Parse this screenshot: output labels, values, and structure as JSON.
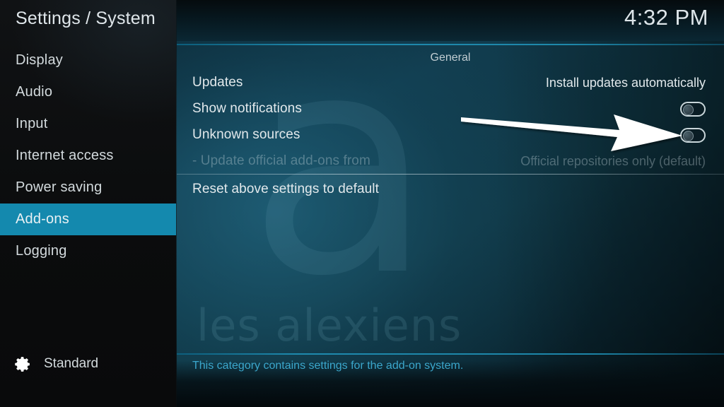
{
  "window": {
    "title": "Settings / System",
    "clock": "4:32 PM"
  },
  "sidebar": {
    "items": [
      {
        "label": "Display",
        "selected": false
      },
      {
        "label": "Audio",
        "selected": false
      },
      {
        "label": "Input",
        "selected": false
      },
      {
        "label": "Internet access",
        "selected": false
      },
      {
        "label": "Power saving",
        "selected": false
      },
      {
        "label": "Add-ons",
        "selected": true
      },
      {
        "label": "Logging",
        "selected": false
      }
    ],
    "settings_level": {
      "icon": "gear-icon",
      "label": "Standard"
    }
  },
  "main": {
    "section_header": "General",
    "rows": [
      {
        "label": "Updates",
        "value": "Install updates automatically",
        "control": "text",
        "enabled": true
      },
      {
        "label": "Show notifications",
        "value": "",
        "control": "toggle",
        "toggle_state": "off",
        "enabled": true
      },
      {
        "label": "Unknown sources",
        "value": "",
        "control": "toggle",
        "toggle_state": "off",
        "enabled": true
      },
      {
        "label": "- Update official add-ons from",
        "value": "Official repositories only (default)",
        "control": "text",
        "enabled": false
      }
    ],
    "reset_row": {
      "label": "Reset above settings to default"
    },
    "footer_help": "This category contains settings for the add-on system."
  },
  "annotation": {
    "arrow_label": "arrow pointing to Unknown sources toggle"
  },
  "watermark": {
    "logo_glyph": "a",
    "text": "les alexiens"
  },
  "colors": {
    "accent": "#1489ae",
    "footer_text": "#3ba7cc",
    "sidebar_bg": "#0d0e0f",
    "content_bg": "#10394a",
    "annotation": "#ffffff"
  }
}
